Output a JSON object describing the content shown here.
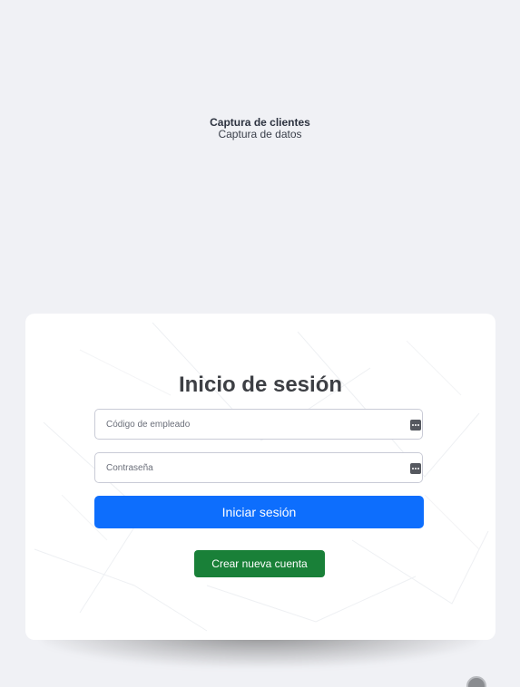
{
  "header": {
    "title": "Captura de clientes",
    "subtitle": "Captura de datos"
  },
  "login": {
    "title": "Inicio de sesión",
    "employee_code": {
      "placeholder": "Código de empleado",
      "value": "",
      "icon": "password-manager-icon"
    },
    "password": {
      "placeholder": "Contraseña",
      "value": "",
      "icon": "password-manager-icon"
    },
    "submit_label": "Iniciar sesión",
    "create_account_label": "Crear nueva cuenta"
  },
  "colors": {
    "background": "#f0f1f5",
    "primary": "#0d6efd",
    "success": "#198038",
    "title": "#3d3f44"
  }
}
